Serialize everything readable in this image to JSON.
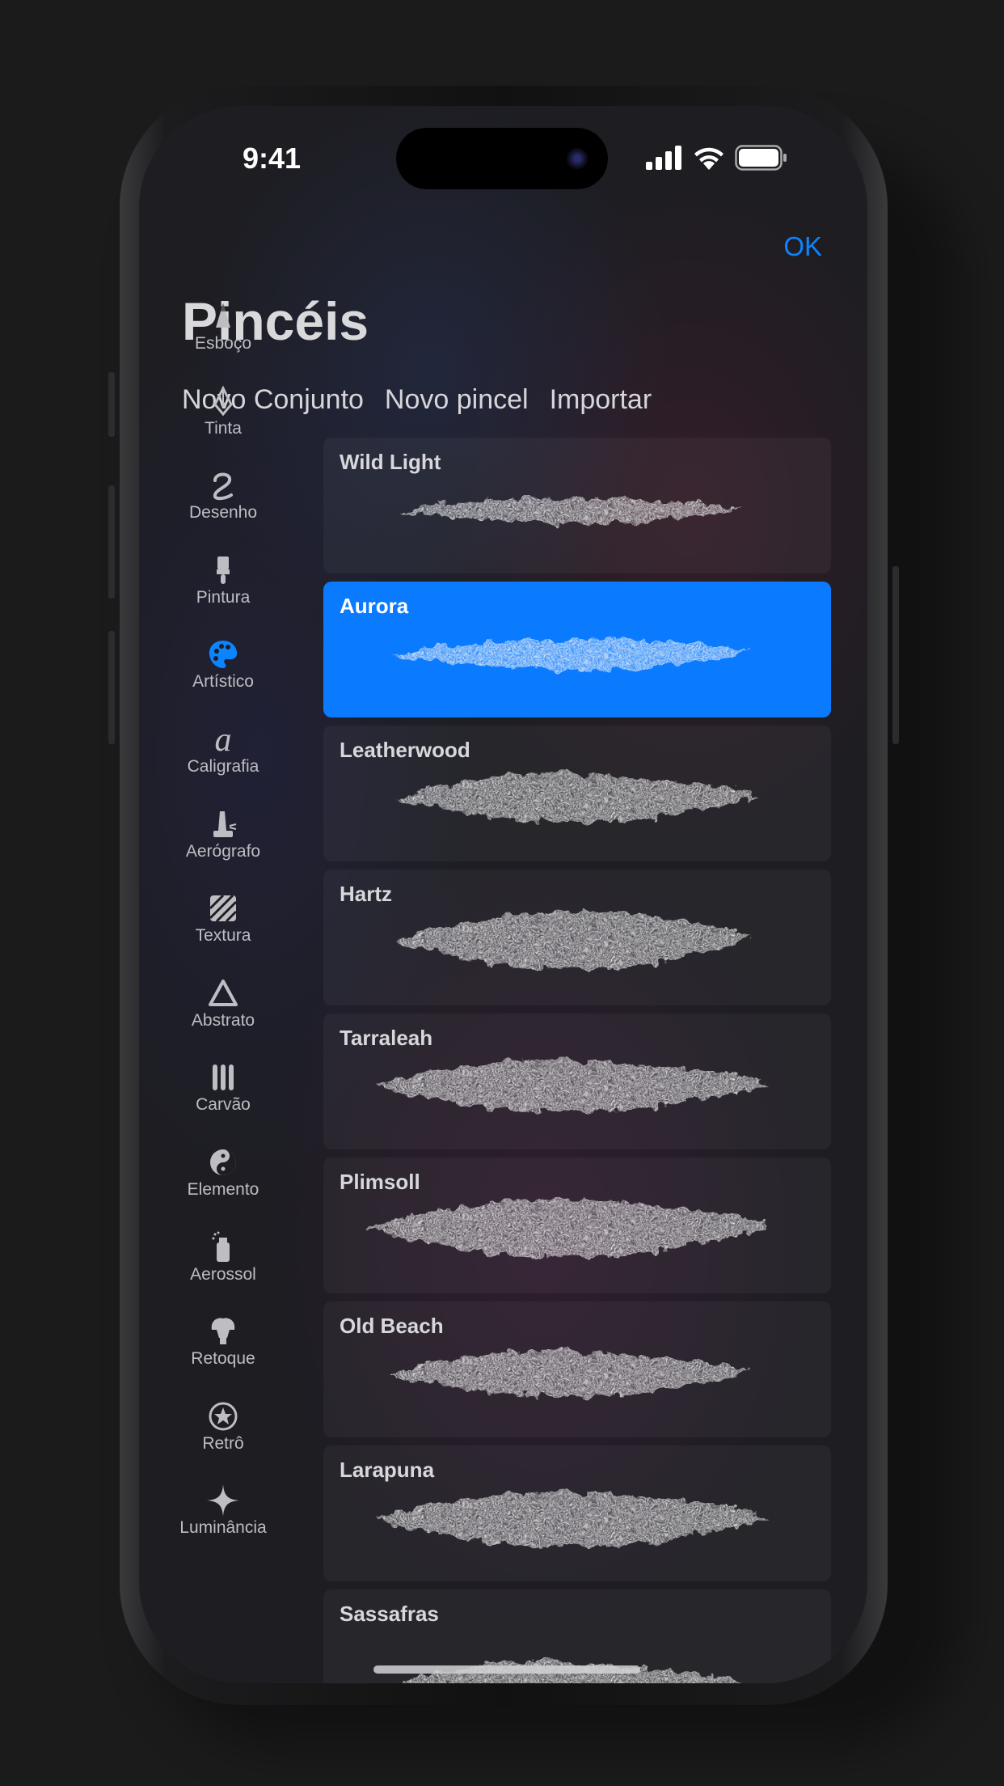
{
  "status_bar": {
    "time": "9:41",
    "icons": [
      "cellular-signal-icon",
      "wifi-icon",
      "battery-icon"
    ]
  },
  "header": {
    "done_label": "OK",
    "title": "Pincéis"
  },
  "menu": {
    "new_set": "Novo Conjunto",
    "new_brush": "Novo pincel",
    "import": "Importar"
  },
  "colors": {
    "accent": "#0a84ff",
    "selected_card": "#0a7aff"
  },
  "sidebar": {
    "selected": "Artístico",
    "items": [
      {
        "label": "Esboço",
        "icon": "pencil-tip-icon"
      },
      {
        "label": "Tinta",
        "icon": "pen-nib-icon"
      },
      {
        "label": "Desenho",
        "icon": "squiggle-icon"
      },
      {
        "label": "Pintura",
        "icon": "paintbrush-icon"
      },
      {
        "label": "Artístico",
        "icon": "palette-icon"
      },
      {
        "label": "Caligrafia",
        "icon": "calligraphy-a-icon"
      },
      {
        "label": "Aerógrafo",
        "icon": "airbrush-icon"
      },
      {
        "label": "Textura",
        "icon": "texture-icon"
      },
      {
        "label": "Abstrato",
        "icon": "triangle-icon"
      },
      {
        "label": "Carvão",
        "icon": "charcoal-sticks-icon"
      },
      {
        "label": "Elemento",
        "icon": "yin-yang-icon"
      },
      {
        "label": "Aerossol",
        "icon": "spray-can-icon"
      },
      {
        "label": "Retoque",
        "icon": "retouch-brush-icon"
      },
      {
        "label": "Retrô",
        "icon": "star-circle-icon"
      },
      {
        "label": "Luminância",
        "icon": "sparkle-icon"
      }
    ]
  },
  "brushes": {
    "selected": "Aurora",
    "items": [
      {
        "name": "Wild Light"
      },
      {
        "name": "Aurora"
      },
      {
        "name": "Leatherwood"
      },
      {
        "name": "Hartz"
      },
      {
        "name": "Tarraleah"
      },
      {
        "name": "Plimsoll"
      },
      {
        "name": "Old Beach"
      },
      {
        "name": "Larapuna"
      },
      {
        "name": "Sassafras"
      }
    ]
  }
}
